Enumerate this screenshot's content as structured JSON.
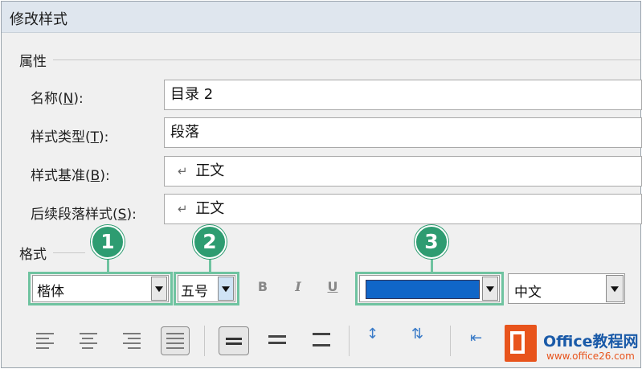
{
  "window": {
    "title": "修改样式"
  },
  "properties": {
    "section_label": "属性",
    "name": {
      "label_prefix": "名称(",
      "mnemonic": "N",
      "label_suffix": "):",
      "value": "目录 2"
    },
    "style_type": {
      "label_prefix": "样式类型(",
      "mnemonic": "T",
      "label_suffix": "):",
      "value": "段落"
    },
    "style_based_on": {
      "label_prefix": "样式基准(",
      "mnemonic": "B",
      "label_suffix": "):",
      "value": "正文",
      "icon": "paragraph-return-icon"
    },
    "next_style": {
      "label_prefix": "后续段落样式(",
      "mnemonic": "S",
      "label_suffix": "):",
      "value": "正文",
      "icon": "paragraph-return-icon"
    }
  },
  "format": {
    "section_label": "格式",
    "font_name": "楷体",
    "font_size": "五号",
    "bold_label": "B",
    "italic_label": "I",
    "underline_label": "U",
    "font_color": "#1066c8",
    "script": "中文"
  },
  "callouts": [
    "1",
    "2",
    "3"
  ],
  "watermark": {
    "brand": "Office教程网",
    "url": "www.office26.com"
  },
  "colors": {
    "highlight": "#6fc3a0",
    "badge": "#2e9c71"
  }
}
